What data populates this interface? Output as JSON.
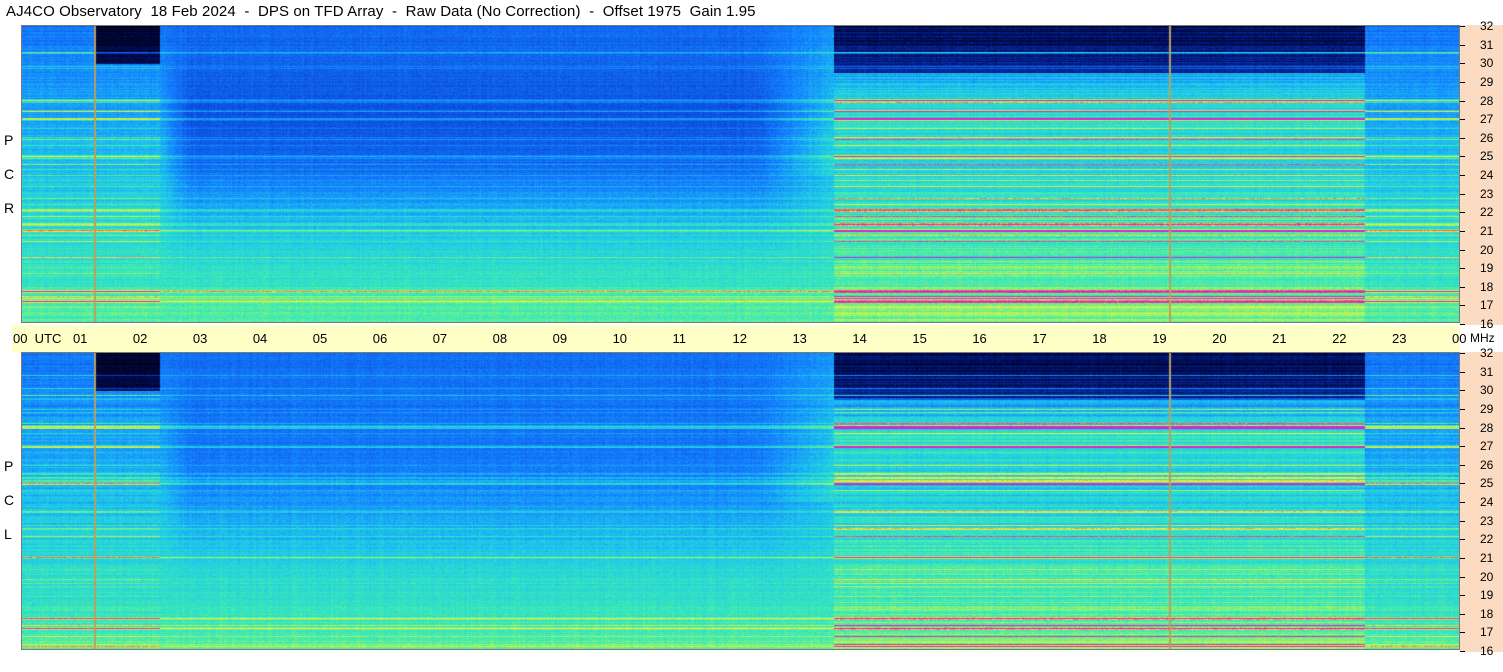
{
  "title": "AJ4CO Observatory  18 Feb 2024  -  DPS on TFD Array  -  Raw Data (No Correction)  -  Offset 1975  Gain 1.95",
  "polarizations": {
    "top": "R C P",
    "bottom": "L C P"
  },
  "time_axis": {
    "ticks": [
      "00  UTC",
      "01",
      "02",
      "03",
      "04",
      "05",
      "06",
      "07",
      "08",
      "09",
      "10",
      "11",
      "12",
      "13",
      "14",
      "15",
      "16",
      "17",
      "18",
      "19",
      "20",
      "21",
      "22",
      "23",
      "00"
    ]
  },
  "freq_axis": {
    "unit": "MHz",
    "ticks": [
      "32",
      "31",
      "30",
      "29",
      "28",
      "27",
      "26",
      "25",
      "24",
      "23",
      "22",
      "21",
      "20",
      "19",
      "18",
      "17",
      "16"
    ]
  },
  "colors": {
    "background": "#ffffff",
    "time_axis_bg": "#ffffc8",
    "freq_axis_bg": "#fbdcc3",
    "marker_line": "#b8a060"
  },
  "chart_data": [
    {
      "type": "heatmap",
      "name": "RCP",
      "x_range_hours_utc": [
        0,
        24
      ],
      "y_range_mhz": [
        16,
        32
      ],
      "markers_hours_utc": [
        1.2,
        19.15
      ],
      "strong_bands_mhz": [
        17.2,
        17.7,
        21.0,
        25.0,
        27.0,
        28.0
      ],
      "colormap": [
        "black",
        "dark-blue",
        "blue",
        "cyan",
        "green",
        "yellow",
        "red",
        "magenta"
      ]
    },
    {
      "type": "heatmap",
      "name": "LCP",
      "x_range_hours_utc": [
        0,
        24
      ],
      "y_range_mhz": [
        16,
        32
      ],
      "markers_hours_utc": [
        1.2,
        19.15
      ],
      "strong_bands_mhz": [
        17.2,
        17.7,
        21.0,
        25.0,
        27.0,
        28.0
      ],
      "colormap": [
        "black",
        "dark-blue",
        "blue",
        "cyan",
        "green",
        "yellow",
        "red",
        "magenta"
      ]
    }
  ]
}
